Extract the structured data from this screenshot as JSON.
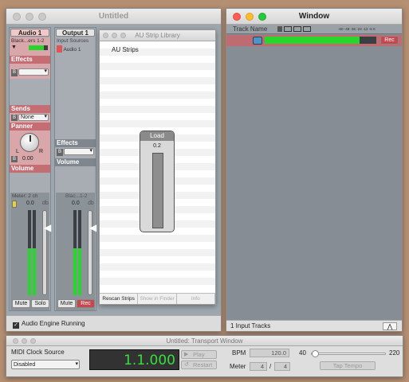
{
  "mixer_window": {
    "title": "Untitled",
    "strip1": {
      "name": "Audio 1",
      "input": "Black...ers 1-2",
      "effects_label": "Effects",
      "sends_label": "Sends",
      "send_value": "None",
      "panner_label": "Panner",
      "pan_l": "L",
      "pan_r": "R",
      "pan_value": "0.00",
      "volume_label": "Volume",
      "meter_label": "Meter: 2 ch",
      "gain": "0.0",
      "unit": "db",
      "meter_level": 0.55,
      "mute": "Mute",
      "solo": "Solo"
    },
    "strip2": {
      "name": "Output 1",
      "input_sources_label": "Input Sources",
      "input_source": "Audio 1",
      "effects_label": "Effects",
      "volume_label": "Volume",
      "channel_label": "Blac...1-2",
      "gain": "0.0",
      "unit": "db",
      "meter_level": 0.55,
      "mute": "Mute",
      "rec": "Rec"
    },
    "status": "Audio Engine Running"
  },
  "au_library": {
    "title": "AU Strip Library",
    "item": "AU Strips",
    "load_label": "Load",
    "load_value": "0.2",
    "buttons": [
      "Rescan Strips",
      "Show in Finder",
      "Info"
    ]
  },
  "tracks_window": {
    "title": "Window",
    "column_label": "Track Name",
    "ruler": "-60 -48 -36 -24 -12 -6 0",
    "rec": "Rec",
    "footer": "1 Input Tracks",
    "meter_level": 0.85
  },
  "transport": {
    "title": "Untitled: Transport Window",
    "midi_label": "MIDI Clock Source",
    "midi_value": "Disabled",
    "position": "1.1.000",
    "play": "Play",
    "restart": "Restart",
    "bpm_label": "BPM",
    "bpm_value": "120.0",
    "tempo_min": "40",
    "tempo_max": "220",
    "meter_label": "Meter",
    "meter_num": "4",
    "meter_sep": "/",
    "meter_den": "4",
    "tap_tempo": "Tap Tempo"
  },
  "colors": {
    "accent_red": "#c4484f",
    "meter_green": "#26d62a",
    "lcd_green": "#35e03d"
  }
}
